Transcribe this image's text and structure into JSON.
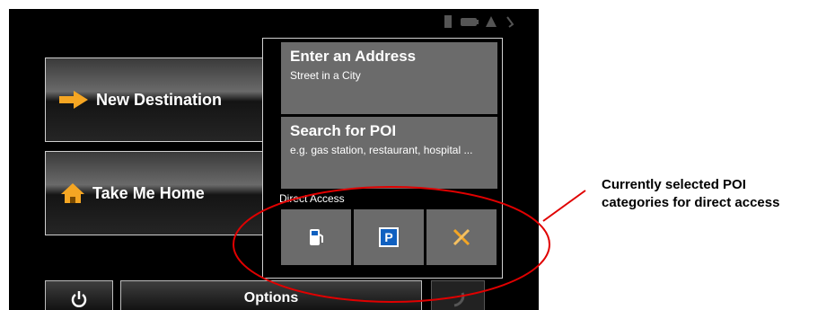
{
  "main_menu": {
    "new_destination_label": "New Destination",
    "take_me_home_label": "Take Me Home"
  },
  "destination_menu": {
    "enter_address": {
      "title": "Enter an Address",
      "subtitle": "Street in a City"
    },
    "search_poi": {
      "title": "Search for POI",
      "subtitle": "e.g. gas station, restaurant, hospital ..."
    },
    "direct_access_label": "Direct Access",
    "direct_access_items": [
      {
        "icon": "gas-station-icon"
      },
      {
        "icon": "parking-icon",
        "text": "P"
      },
      {
        "icon": "restaurant-icon"
      }
    ]
  },
  "bottom_bar": {
    "power_icon": "power-icon",
    "options_label": "Options",
    "back_icon": "back-icon"
  },
  "status_bar": {
    "icons": [
      "phone-icon",
      "battery-icon",
      "gps-signal-icon",
      "sound-icon"
    ]
  },
  "annotation": {
    "line1": "Currently selected POI",
    "line2": "categories for direct access",
    "color": "#e00000"
  },
  "colors": {
    "menu_card": "#6b6b6b",
    "accent_orange": "#f5a623",
    "parking_blue": "#1060c0"
  }
}
